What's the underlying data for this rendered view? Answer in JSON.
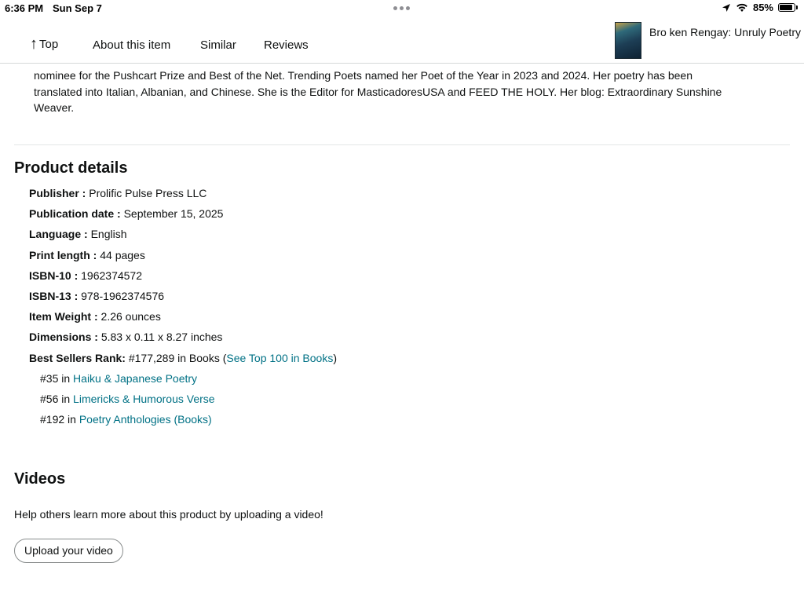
{
  "status_bar": {
    "time": "6:36 PM",
    "date": "Sun Sep 7",
    "battery": "85%",
    "icons": [
      "location-arrow-icon",
      "wifi-icon",
      "battery-icon"
    ]
  },
  "nav": {
    "top_label": "Top",
    "about_label": "About this item",
    "similar_label": "Similar",
    "reviews_label": "Reviews",
    "product_title": "Bro ken Rengay: Unruly Poetry"
  },
  "bio": {
    "line1": "nominee for the Pushcart Prize and Best of the Net. Trending Poets named her Poet of the Year in 2023 and 2024. Her poetry has been",
    "line2": "translated into Italian, Albanian, and Chinese. She is the Editor for MasticadoresUSA and FEED THE HOLY. Her blog: Extraordinary Sunshine",
    "line3": "Weaver."
  },
  "product_details": {
    "title": "Product details",
    "rows": [
      {
        "label": "Publisher",
        "value": "Prolific Pulse Press LLC"
      },
      {
        "label": "Publication date",
        "value": "September 15, 2025"
      },
      {
        "label": "Language",
        "value": "English"
      },
      {
        "label": "Print length",
        "value": "44 pages"
      },
      {
        "label": "ISBN-10",
        "value": "1962374572"
      },
      {
        "label": "ISBN-13",
        "value": "978-1962374576"
      },
      {
        "label": "Item Weight",
        "value": "2.26 ounces"
      },
      {
        "label": "Dimensions",
        "value": "5.83 x 0.11 x 8.27 inches"
      }
    ],
    "sep": " : ",
    "best_sellers": {
      "label": "Best Sellers Rank:",
      "value": " #177,289 in Books (",
      "link": "See Top 100 in Books",
      "close": ")",
      "subranks": [
        {
          "rank": "#35 in ",
          "category": "Haiku & Japanese Poetry"
        },
        {
          "rank": "#56 in ",
          "category": "Limericks & Humorous Verse"
        },
        {
          "rank": "#192 in ",
          "category": "Poetry Anthologies (Books)"
        }
      ]
    }
  },
  "videos": {
    "title": "Videos",
    "help_text": "Help others learn more about this product by uploading a video!",
    "upload_button": "Upload your video"
  },
  "colors": {
    "link": "#007185",
    "text": "#0f1111",
    "divider": "#e3e6e6"
  }
}
